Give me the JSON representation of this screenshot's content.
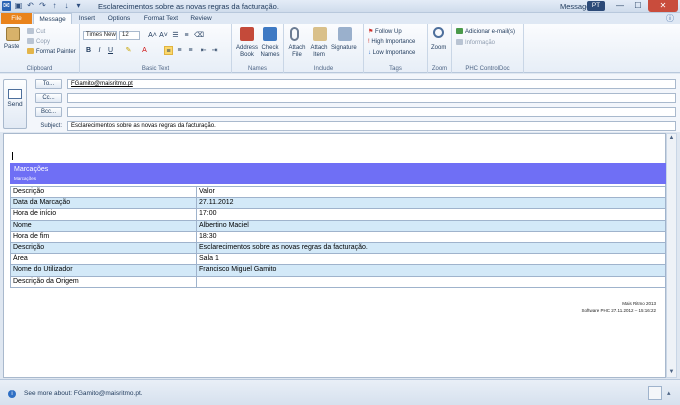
{
  "window": {
    "title": "Esclarecimentos sobre as novas regras da facturação.",
    "title_suffix": "Message",
    "language_badge": "PT",
    "min": "—",
    "max": "☐",
    "close": "✕"
  },
  "quick_access": [
    "save-icon",
    "undo-icon",
    "redo-icon",
    "up-icon",
    "down-icon",
    "customize-icon"
  ],
  "tabs": [
    {
      "label": "File"
    },
    {
      "label": "Message"
    },
    {
      "label": "Insert"
    },
    {
      "label": "Options"
    },
    {
      "label": "Format Text"
    },
    {
      "label": "Review"
    }
  ],
  "ribbon": {
    "clipboard": {
      "paste": "Paste",
      "cut": "Cut",
      "copy": "Copy",
      "format_painter": "Format Painter",
      "group": "Clipboard"
    },
    "basic_text": {
      "font": "Times New",
      "size": "12",
      "group": "Basic Text",
      "bold": "B",
      "italic": "I",
      "underline": "U",
      "grow": "A˄",
      "shrink": "A˅"
    },
    "names": {
      "address_book": "Address Book",
      "check_names": "Check Names",
      "group": "Names"
    },
    "include": {
      "attach_file": "Attach File",
      "attach_item": "Attach Item",
      "signature": "Signature",
      "group": "Include"
    },
    "tags": {
      "follow_up": "Follow Up",
      "high": "High Importance",
      "low": "Low Importance",
      "group": "Tags"
    },
    "zoom": {
      "zoom": "Zoom",
      "group": "Zoom"
    },
    "phc": {
      "add_email": "Adicionar e-mail(s)",
      "info": "Informação",
      "group": "PHC ControlDoc"
    }
  },
  "header": {
    "send": "Send",
    "to_btn": "To...",
    "cc_btn": "Cc...",
    "bcc_btn": "Bcc...",
    "subject_label": "Subject:",
    "to_value": "FGamito@maisritmo.pt",
    "cc_value": "",
    "bcc_value": "",
    "subject_value": "Esclarecimentos sobre as novas regras da facturação."
  },
  "body": {
    "banner_title": "Marcações",
    "banner_subtitle": "Marcações",
    "rows": [
      {
        "label": "Descrição",
        "value": "Valor"
      },
      {
        "label": "Data da Marcação",
        "value": "27.11.2012"
      },
      {
        "label": "Hora de início",
        "value": "17:00"
      },
      {
        "label": "Nome",
        "value": "Albertino Maciel"
      },
      {
        "label": "Hora de fim",
        "value": "18:30"
      },
      {
        "label": "Descrição",
        "value": "Esclarecimentos sobre as novas regras da facturação."
      },
      {
        "label": "Área",
        "value": "Sala 1"
      },
      {
        "label": "Nome do Utilizador",
        "value": "Francisco Miguel Gamito"
      },
      {
        "label": "Descrição da Origem",
        "value": ""
      }
    ],
    "footer_line1": "Mais Ritmo 2013",
    "footer_line2": "Software PHC 27.11.2012 – 15:16:22"
  },
  "status": {
    "text": "See more about: FGamito@maisritmo.pt."
  },
  "colors": {
    "banner": "#6f6ff5",
    "alt_row": "#d3e9f8",
    "file_tab": "#e9831c"
  }
}
